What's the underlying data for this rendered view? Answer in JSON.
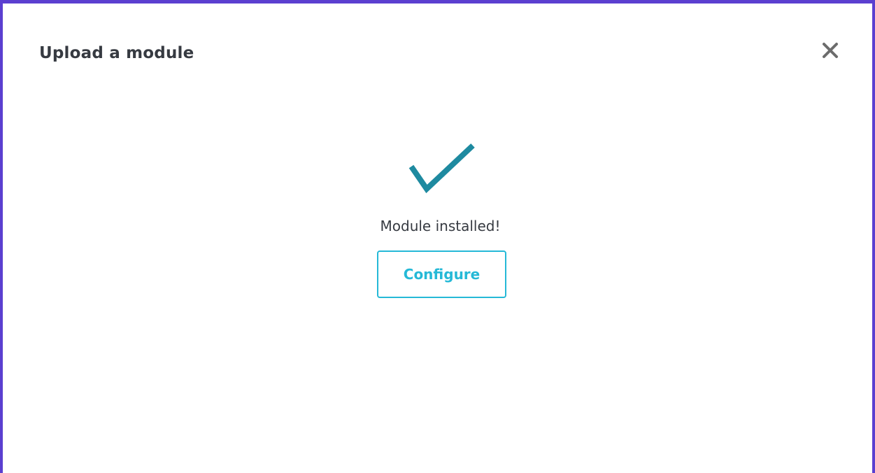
{
  "modal": {
    "title": "Upload a module",
    "close_icon": "close-icon",
    "success_icon": "checkmark-icon",
    "message": "Module installed!",
    "configure_label": "Configure"
  },
  "colors": {
    "frame_border": "#5b3fd0",
    "title_text": "#363a41",
    "checkmark": "#1e8aa0",
    "accent": "#25b9d7",
    "close_icon": "#6c6c6c"
  }
}
